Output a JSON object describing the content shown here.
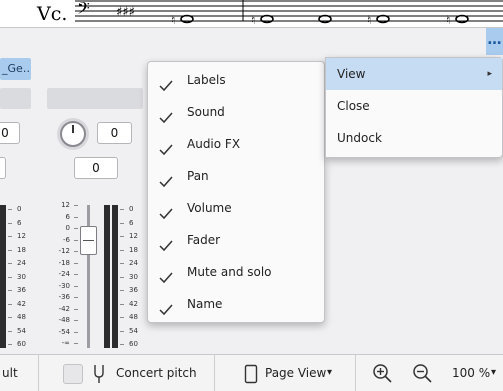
{
  "score": {
    "instrument_label": "Vc."
  },
  "mixer": {
    "more_button_label": "…",
    "channel_name": "_Ge…",
    "channel_prev": {
      "pan_value": "0",
      "volume_value": "0"
    },
    "channel_main": {
      "pan_value": "0",
      "volume_value": "0"
    },
    "meter_scale": [
      "0",
      "6",
      "12",
      "18",
      "24",
      "30",
      "36",
      "42",
      "48",
      "54",
      "60"
    ],
    "fader_scale": [
      "12",
      "6",
      "0",
      "-6",
      "-12",
      "-18",
      "-24",
      "-30",
      "-36",
      "-42",
      "-48",
      "-54",
      "-∞"
    ]
  },
  "context_menu": {
    "items": [
      {
        "label": "Labels",
        "checked": true
      },
      {
        "label": "Sound",
        "checked": true
      },
      {
        "label": "Audio FX",
        "checked": true
      },
      {
        "label": "Pan",
        "checked": true
      },
      {
        "label": "Volume",
        "checked": true
      },
      {
        "label": "Fader",
        "checked": true
      },
      {
        "label": "Mute and solo",
        "checked": true
      },
      {
        "label": "Name",
        "checked": true
      }
    ]
  },
  "panel_menu": {
    "items": [
      {
        "label": "View",
        "submenu_arrow": "▸"
      },
      {
        "label": "Close"
      },
      {
        "label": "Undock"
      }
    ]
  },
  "statusbar": {
    "left_text": "ult",
    "concert_pitch_label": "Concert pitch",
    "page_view_label": "Page View",
    "dropdown_arrow": "▾",
    "zoom_value": "100 %"
  },
  "colors": {
    "accent": "#a9cbee",
    "menu_highlight": "#c6dcf3",
    "meter": "#2c2c2e"
  }
}
